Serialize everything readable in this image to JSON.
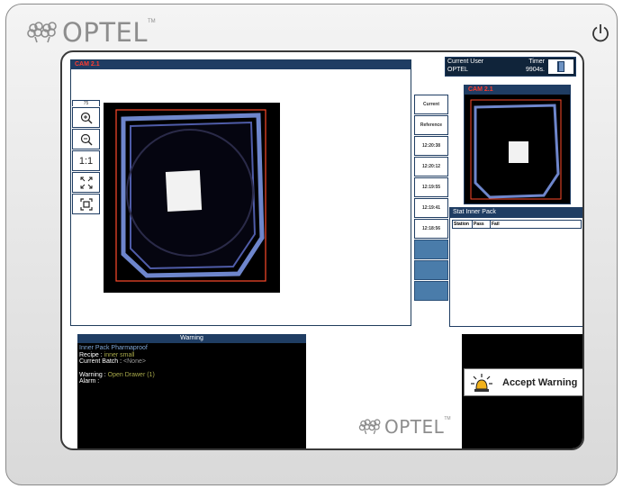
{
  "brand": {
    "logo_text": "OPTEL",
    "trademark": "TM"
  },
  "camera": {
    "title": "CAM 2.1",
    "zoom_percent": "75"
  },
  "tools": [
    {
      "name": "zoom-in-button",
      "label": "⊕"
    },
    {
      "name": "zoom-out-button",
      "label": "⊖"
    },
    {
      "name": "actual-size-button",
      "label": "1:1"
    },
    {
      "name": "fit-button",
      "label": "⤡"
    },
    {
      "name": "fullscreen-button",
      "label": "⛶"
    }
  ],
  "history": [
    "Current",
    "Reference",
    "12:20:38",
    "12:20:12",
    "12:19:55",
    "12:19:41",
    "12:18:56"
  ],
  "user": {
    "current_user_label": "Current User",
    "timer_label": "Timer",
    "user": "OPTEL",
    "timer": "9904s."
  },
  "reference_cam": {
    "title": "CAM 2.1"
  },
  "stat": {
    "title": "Stat Inner Pack",
    "columns": [
      "Station",
      "Pass",
      "Fail"
    ]
  },
  "warning": {
    "title": "Warning",
    "product": "Inner Pack Pharmaproof",
    "recipe_label": "Recipe :",
    "recipe_value": "inner small",
    "batch_label": "Current Batch :",
    "batch_value": "<None>",
    "warning_label": "Warning :",
    "warning_value": "Open Drawer (1)",
    "alarm_label": "Alarm :"
  },
  "accept_button": {
    "label": "Accept Warning"
  },
  "colors": {
    "title_bar": "#1f3d63",
    "cam_title_text": "#ff3b2f",
    "roi": "#ff4a2a"
  }
}
